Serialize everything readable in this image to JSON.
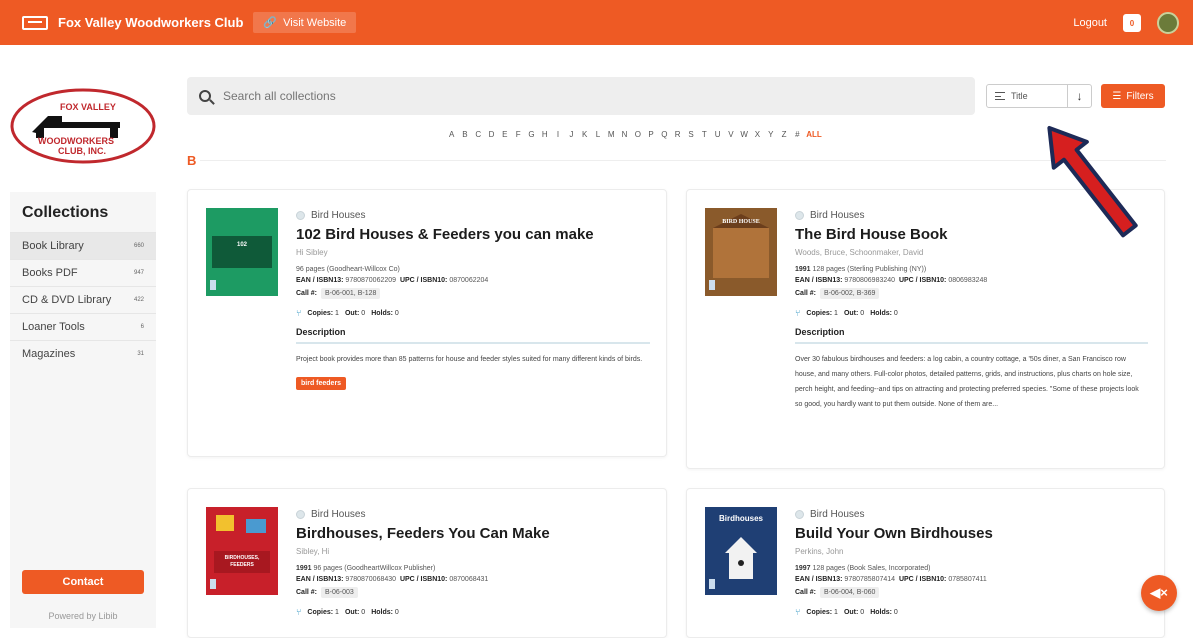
{
  "topbar": {
    "brand": "Fox Valley Woodworkers Club",
    "visit_label": "Visit Website",
    "logout_label": "Logout",
    "bag_count": "0"
  },
  "logo": {
    "line1": "FOX VALLEY",
    "line2": "WOODWORKERS",
    "line3": "CLUB, INC."
  },
  "sidebar": {
    "title": "Collections",
    "items": [
      {
        "label": "Book Library",
        "count": "660"
      },
      {
        "label": "Books PDF",
        "count": "947"
      },
      {
        "label": "CD & DVD Library",
        "count": "422"
      },
      {
        "label": "Loaner Tools",
        "count": "6"
      },
      {
        "label": "Magazines",
        "count": "31"
      }
    ],
    "contact_label": "Contact",
    "powered_by": "Powered by Libib"
  },
  "search": {
    "placeholder": "Search all collections"
  },
  "sort": {
    "label": "Title",
    "direction_icon": "arrow-down-icon",
    "filters_label": "Filters"
  },
  "alphabet": [
    "A",
    "B",
    "C",
    "D",
    "E",
    "F",
    "G",
    "H",
    "I",
    "J",
    "K",
    "L",
    "M",
    "N",
    "O",
    "P",
    "Q",
    "R",
    "S",
    "T",
    "U",
    "V",
    "W",
    "X",
    "Y",
    "Z",
    "#"
  ],
  "alphabet_all": "ALL",
  "section_letter": "B",
  "labels": {
    "ean": "EAN / ISBN13:",
    "upc": "UPC / ISBN10:",
    "call": "Call #:",
    "copies": "Copies:",
    "out": "Out:",
    "holds": "Holds:",
    "description": "Description"
  },
  "cards": [
    {
      "category": "Bird Houses",
      "title": "102 Bird Houses & Feeders you can make",
      "author": "Hi Sibley",
      "year": "",
      "pages_publisher": "96 pages  (Goodheart-Willcox Co)",
      "ean": "9780870062209",
      "upc": "0870062204",
      "call": "B-06-001, B-128",
      "copies": "1",
      "out": "0",
      "holds": "0",
      "description": "Project book provides more than 85 patterns for house and feeder styles suited for many different kinds of birds.",
      "tag": "bird feeders"
    },
    {
      "category": "Bird Houses",
      "title": "The Bird House Book",
      "author": "Woods, Bruce, Schoonmaker, David",
      "year": "1991",
      "pages_publisher": "128 pages  (Sterling Publishing (NY))",
      "ean": "9780806983240",
      "upc": "0806983248",
      "call": "B-06-002, B-369",
      "copies": "1",
      "out": "0",
      "holds": "0",
      "description": "Over 30 fabulous birdhouses and feeders: a log cabin, a country cottage, a '50s diner, a San Francisco row house, and many others. Full-color photos, detailed patterns, grids, and instructions, plus charts on hole size, perch height, and feeding--and tips on attracting and protecting preferred species. \"Some of these projects look so good, you hardly want to put them outside. None of them are...",
      "tag": ""
    },
    {
      "category": "Bird Houses",
      "title": "Birdhouses, Feeders You Can Make",
      "author": "Sibley, Hi",
      "year": "1991",
      "pages_publisher": "96 pages  (GoodheartWillcox Publisher)",
      "ean": "9780870068430",
      "upc": "0870068431",
      "call": "B-06-003",
      "copies": "1",
      "out": "0",
      "holds": "0"
    },
    {
      "category": "Bird Houses",
      "title": "Build Your Own Birdhouses",
      "author": "Perkins, John",
      "year": "1997",
      "pages_publisher": "128 pages  (Book Sales, Incorporated)",
      "ean": "9780785807414",
      "upc": "0785807411",
      "call": "B-06-004, B-060",
      "copies": "1",
      "out": "0",
      "holds": "0"
    }
  ],
  "colors": {
    "accent": "#ee5a24",
    "annotation_arrow": "#d61f1f"
  }
}
